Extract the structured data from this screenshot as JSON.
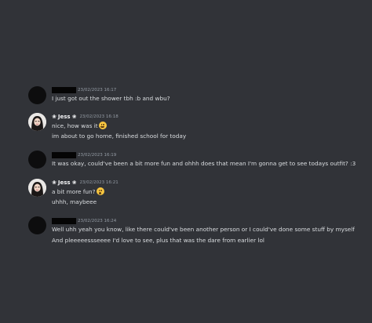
{
  "messages": [
    {
      "author": "",
      "timestamp": "23/02/2023 16:17",
      "lines": [
        "I just got out the shower tbh :b and wbu?"
      ]
    },
    {
      "author": "Jess",
      "badge": "❀",
      "timestamp": "23/02/2023 16:18",
      "lines": [
        "nice, how was it",
        "im about to go home, finished school for today"
      ],
      "emoji_after_line1": "grinning-face-emoji"
    },
    {
      "author": "",
      "timestamp": "23/02/2023 16:19",
      "lines": [
        "It was okay, could've been a bit more fun and ohhh does that mean I'm gonna get to see todays outfit? :3"
      ]
    },
    {
      "author": "Jess",
      "badge": "❀",
      "timestamp": "23/02/2023 16:21",
      "lines": [
        "a bit more fun?",
        "uhhh, maybeee"
      ],
      "emoji_after_line1": "astonished-face-emoji"
    },
    {
      "author": "",
      "timestamp": "23/02/2023 16:24",
      "lines": [
        "Well uhh yeah you know, like there could've been another person or I could've  done some stuff by myself",
        "And pleeeeessseeee I'd love to see, plus that was the dare from earlier lol"
      ]
    }
  ],
  "colors": {
    "background": "#313338",
    "text": "#dbdee1",
    "timestamp": "#949ba4",
    "redaction": "#050505"
  }
}
